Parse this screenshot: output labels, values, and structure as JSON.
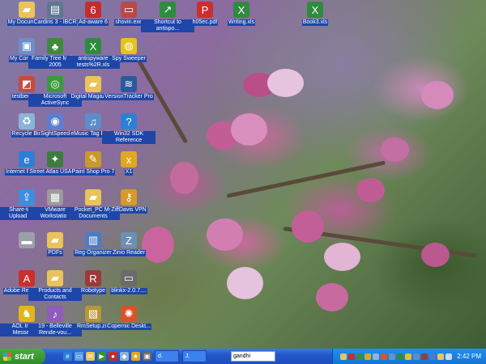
{
  "desktop_icons": [
    {
      "label": "My Documents",
      "icon": "folder-icon",
      "color": "#e9c45a"
    },
    {
      "label": "My Computer",
      "icon": "computer-icon",
      "color": "#6c8fc7"
    },
    {
      "label": "testbed.png",
      "icon": "image-file-icon",
      "color": "#c74b3a"
    },
    {
      "label": "Recycle Bin",
      "icon": "recycle-bin-icon",
      "color": "#8ab4d9"
    },
    {
      "label": "Internet Explorer",
      "icon": "internet-explorer-icon",
      "color": "#2d7fd6"
    },
    {
      "label": "Share-to-Web Upload Folder",
      "icon": "upload-folder-icon",
      "color": "#3d8ee0"
    },
    {
      "label": "",
      "icon": "drive-icon",
      "color": "#9aa0a8"
    },
    {
      "label": "Adobe Reader 6.0",
      "icon": "adobe-reader-icon",
      "color": "#cc2d2d"
    },
    {
      "label": "AOL Instant Messenger",
      "icon": "aim-icon",
      "color": "#e3b51c"
    },
    {
      "label": "Cardiris 3 - IBCR",
      "icon": "scanner-icon",
      "color": "#5d7790"
    },
    {
      "label": "Family Tree Maker 2005",
      "icon": "family-tree-icon",
      "color": "#3f8a3a"
    },
    {
      "label": "Microsoft ActiveSync",
      "icon": "activesync-icon",
      "color": "#3a9b3a"
    },
    {
      "label": "SightSpeed",
      "icon": "sightspeed-icon",
      "color": "#5a7fd1"
    },
    {
      "label": "Street Atlas USA 8.0",
      "icon": "map-icon",
      "color": "#3c7d3f"
    },
    {
      "label": "VMware Workstation",
      "icon": "vmware-icon",
      "color": "#9b9b9b"
    },
    {
      "label": "PDFs",
      "icon": "folder-icon",
      "color": "#e9c45a"
    },
    {
      "label": "Products and Contacts",
      "icon": "folder-icon",
      "color": "#e9c45a"
    },
    {
      "label": "19 - Belleville Rende-vou...",
      "icon": "audio-file-icon",
      "color": "#8f5bbd"
    },
    {
      "label": "Ad-aware 6",
      "icon": "adaware-icon",
      "color": "#c42d2d"
    },
    {
      "label": "antispyware tests%2R.xls",
      "icon": "excel-file-icon",
      "color": "#2f8b3e"
    },
    {
      "label": "Digital Magazines",
      "icon": "folder-icon",
      "color": "#e9c45a"
    },
    {
      "label": "eMusic Tag Editor",
      "icon": "emusic-icon",
      "color": "#5b8dc9"
    },
    {
      "label": "Paint Shop Pro 7",
      "icon": "paint-shop-icon",
      "color": "#c79b2b"
    },
    {
      "label": "Pocket_PC My Documents",
      "icon": "folder-icon",
      "color": "#e9c45a"
    },
    {
      "label": "Reg Organizer",
      "icon": "reg-organizer-icon",
      "color": "#4c7cc3"
    },
    {
      "label": "Robotype",
      "icon": "robotype-icon",
      "color": "#9c3a3a"
    },
    {
      "label": "RmSetup.zip",
      "icon": "zip-file-icon",
      "color": "#b99638"
    },
    {
      "label": "shovin.exe",
      "icon": "exe-file-icon",
      "color": "#b84a4a"
    },
    {
      "label": "Spy Sweeper",
      "icon": "spy-sweeper-icon",
      "color": "#e7c21e"
    },
    {
      "label": "VersionTracker Pro",
      "icon": "versiontracker-icon",
      "color": "#2a5a9a"
    },
    {
      "label": "Win32 SDK Reference",
      "icon": "help-icon",
      "color": "#2d7fd6"
    },
    {
      "label": "X1",
      "icon": "x1-icon",
      "color": "#e0a81f"
    },
    {
      "label": "ZiffDavis VPN",
      "icon": "vpn-icon",
      "color": "#d69a2a"
    },
    {
      "label": "Zinio Reader",
      "icon": "zinio-icon",
      "color": "#6c8fb5"
    },
    {
      "label": "blinkx-2.0.7....",
      "icon": "exe-file-icon",
      "color": "#6b6b6b"
    },
    {
      "label": "Copernic Deskt...",
      "icon": "copernic-icon",
      "color": "#d9532a"
    },
    {
      "label": "Shortcut to antispo...",
      "icon": "shortcut-icon",
      "color": "#2f8b3e"
    },
    {
      "label": "h05ec.pdf",
      "icon": "pdf-file-icon",
      "color": "#cc2d2d"
    },
    {
      "label": "Writing.xls",
      "icon": "excel-file-icon",
      "color": "#2f8b3e"
    },
    {
      "label": "Book3.xls",
      "icon": "excel-file-icon",
      "color": "#2f8b3e"
    }
  ],
  "taskbar": {
    "start_label": "start",
    "tasks": [
      "d.",
      "J."
    ],
    "address_value": "gandhi",
    "clock": "2:42 PM"
  }
}
